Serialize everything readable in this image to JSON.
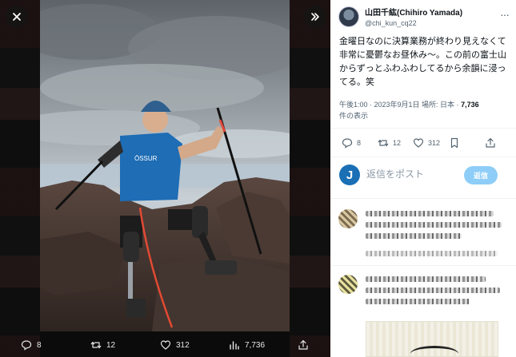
{
  "viewer": {
    "close_icon": "close-icon",
    "next_icon": "chevrons-right-icon",
    "actions": {
      "replies": "8",
      "retweets": "12",
      "likes": "312",
      "views": "7,736"
    }
  },
  "tweet": {
    "author_name": "山田千紘(Chihiro Yamada)",
    "author_handle": "@chi_kun_cq22",
    "text": "金曜日なのに決算業務が終わり見えなくて非常に憂鬱なお昼休み〜。この前の富士山からずっとふわふわしてるから余韻に浸ってる。笑",
    "time": "午後1:00 · 2023年9月1日 場所: 日本 · ",
    "views_count": "7,736",
    "views_label": "件の表示",
    "stats": {
      "replies": "8",
      "retweets": "12",
      "likes": "312"
    },
    "reply_placeholder": "返信をポスト",
    "reply_button": "返信",
    "reply_avatar_letter": "J"
  },
  "colors": {
    "accent": "#1d9bf0",
    "reply_button": "#8ecdf7",
    "muted": "#536471"
  }
}
